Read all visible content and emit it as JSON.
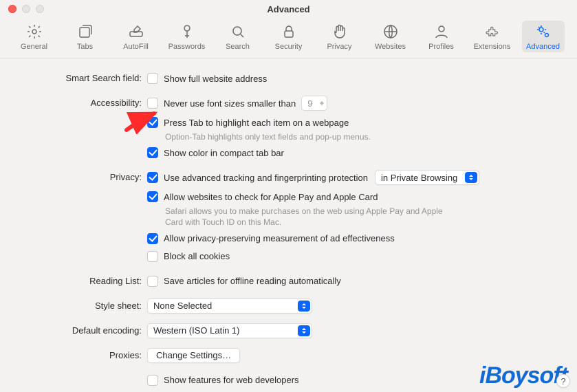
{
  "window": {
    "title": "Advanced"
  },
  "toolbar": {
    "tabs": [
      {
        "id": "general",
        "label": "General"
      },
      {
        "id": "tabs",
        "label": "Tabs"
      },
      {
        "id": "autofill",
        "label": "AutoFill"
      },
      {
        "id": "passwords",
        "label": "Passwords"
      },
      {
        "id": "search",
        "label": "Search"
      },
      {
        "id": "security",
        "label": "Security"
      },
      {
        "id": "privacy",
        "label": "Privacy"
      },
      {
        "id": "websites",
        "label": "Websites"
      },
      {
        "id": "profiles",
        "label": "Profiles"
      },
      {
        "id": "extensions",
        "label": "Extensions"
      },
      {
        "id": "advanced",
        "label": "Advanced",
        "active": true
      }
    ]
  },
  "sections": {
    "smart_search": {
      "label": "Smart Search field:",
      "show_full_address": "Show full website address"
    },
    "accessibility": {
      "label": "Accessibility:",
      "never_use_font": "Never use font sizes smaller than",
      "min_font_size": "9",
      "press_tab": "Press Tab to highlight each item on a webpage",
      "press_tab_sub": "Option-Tab highlights only text fields and pop-up menus.",
      "show_color": "Show color in compact tab bar"
    },
    "privacy": {
      "label": "Privacy:",
      "use_tracking": "Use advanced tracking and fingerprinting protection",
      "tracking_mode": "in Private Browsing",
      "allow_applepay": "Allow websites to check for Apple Pay and Apple Card",
      "applepay_sub": "Safari allows you to make purchases on the web using Apple Pay and Apple Card with Touch ID on this Mac.",
      "allow_ad": "Allow privacy-preserving measurement of ad effectiveness",
      "block_cookies": "Block all cookies"
    },
    "reading_list": {
      "label": "Reading List:",
      "save_offline": "Save articles for offline reading automatically"
    },
    "style_sheet": {
      "label": "Style sheet:",
      "value": "None Selected"
    },
    "default_encoding": {
      "label": "Default encoding:",
      "value": "Western (ISO Latin 1)"
    },
    "proxies": {
      "label": "Proxies:",
      "button": "Change Settings…"
    },
    "dev": {
      "show_features": "Show features for web developers"
    }
  },
  "help": "?",
  "watermark": "iBoysoft"
}
